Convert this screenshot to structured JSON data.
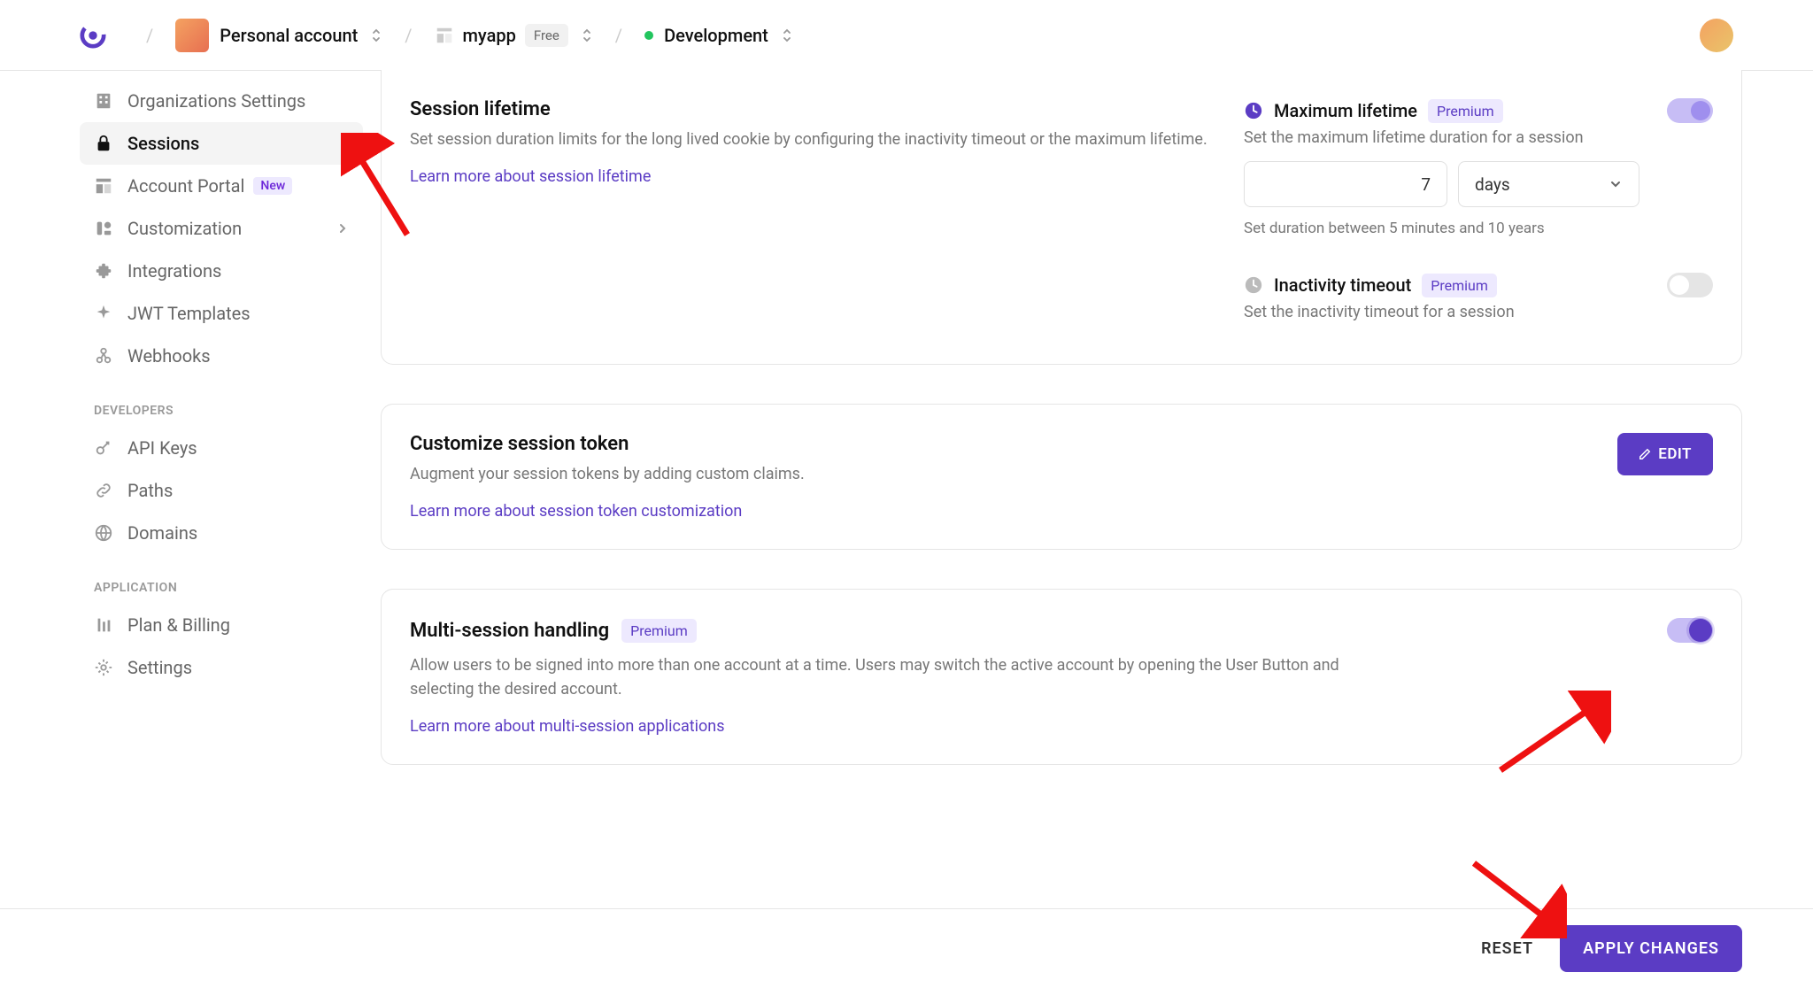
{
  "header": {
    "account": "Personal account",
    "app": "myapp",
    "app_badge": "Free",
    "env": "Development"
  },
  "sidebar": {
    "items": [
      {
        "label": "Organizations Settings"
      },
      {
        "label": "Sessions"
      },
      {
        "label": "Account Portal",
        "badge": "New"
      },
      {
        "label": "Customization"
      },
      {
        "label": "Integrations"
      },
      {
        "label": "JWT Templates"
      },
      {
        "label": "Webhooks"
      }
    ],
    "section_dev": "DEVELOPERS",
    "dev_items": [
      {
        "label": "API Keys"
      },
      {
        "label": "Paths"
      },
      {
        "label": "Domains"
      }
    ],
    "section_app": "APPLICATION",
    "app_items": [
      {
        "label": "Plan & Billing"
      },
      {
        "label": "Settings"
      }
    ]
  },
  "lifetime": {
    "title": "Session lifetime",
    "desc": "Set session duration limits for the long lived cookie by configuring the inactivity timeout or the maximum lifetime.",
    "link": "Learn more about session lifetime",
    "max_title": "Maximum lifetime",
    "premium": "Premium",
    "max_desc": "Set the maximum lifetime duration for a session",
    "max_value": "7",
    "max_unit": "days",
    "max_hint": "Set duration between 5 minutes and 10 years",
    "inact_title": "Inactivity timeout",
    "inact_desc": "Set the inactivity timeout for a session"
  },
  "token": {
    "title": "Customize session token",
    "desc": "Augment your session tokens by adding custom claims.",
    "link": "Learn more about session token customization",
    "edit": "EDIT"
  },
  "multi": {
    "title": "Multi-session handling",
    "premium": "Premium",
    "desc": "Allow users to be signed into more than one account at a time. Users may switch the active account by opening the User Button and selecting the desired account.",
    "link": "Learn more about multi-session applications"
  },
  "footer": {
    "reset": "RESET",
    "apply": "APPLY CHANGES"
  }
}
